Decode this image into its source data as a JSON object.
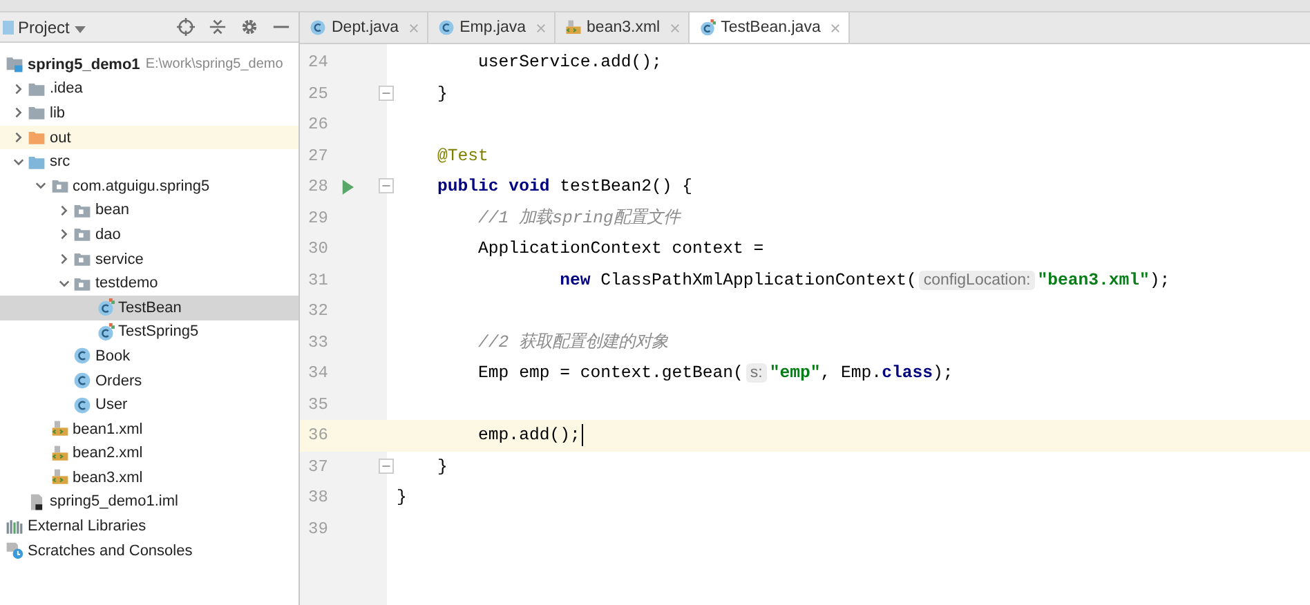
{
  "project_panel": {
    "title": "Project",
    "tree": [
      {
        "label": "spring5_demo1",
        "path": "E:\\work\\spring5_demo",
        "kind": "module",
        "selected": false,
        "highlighted": false,
        "children": [
          {
            "label": ".idea",
            "kind": "folder",
            "expanded": false,
            "selected": false,
            "highlighted": false
          },
          {
            "label": "lib",
            "kind": "folder",
            "expanded": false,
            "selected": false,
            "highlighted": false
          },
          {
            "label": "out",
            "kind": "excluded-folder",
            "expanded": false,
            "selected": false,
            "highlighted": true
          },
          {
            "label": "src",
            "kind": "source-folder",
            "expanded": true,
            "selected": false,
            "highlighted": false,
            "children": [
              {
                "label": "com.atguigu.spring5",
                "kind": "package",
                "expanded": true,
                "selected": false,
                "highlighted": false,
                "children": [
                  {
                    "label": "bean",
                    "kind": "package",
                    "expanded": false,
                    "selected": false,
                    "highlighted": false
                  },
                  {
                    "label": "dao",
                    "kind": "package",
                    "expanded": false,
                    "selected": false,
                    "highlighted": false
                  },
                  {
                    "label": "service",
                    "kind": "package",
                    "expanded": false,
                    "selected": false,
                    "highlighted": false
                  },
                  {
                    "label": "testdemo",
                    "kind": "package",
                    "expanded": true,
                    "selected": false,
                    "highlighted": false,
                    "children": [
                      {
                        "label": "TestBean",
                        "kind": "test-class",
                        "selected": true,
                        "highlighted": false
                      },
                      {
                        "label": "TestSpring5",
                        "kind": "test-class",
                        "selected": false,
                        "highlighted": false
                      }
                    ]
                  },
                  {
                    "label": "Book",
                    "kind": "class",
                    "selected": false,
                    "highlighted": false
                  },
                  {
                    "label": "Orders",
                    "kind": "class",
                    "selected": false,
                    "highlighted": false
                  },
                  {
                    "label": "User",
                    "kind": "class",
                    "selected": false,
                    "highlighted": false
                  }
                ]
              },
              {
                "label": "bean1.xml",
                "kind": "xml",
                "selected": false,
                "highlighted": false
              },
              {
                "label": "bean2.xml",
                "kind": "xml",
                "selected": false,
                "highlighted": false
              },
              {
                "label": "bean3.xml",
                "kind": "xml",
                "selected": false,
                "highlighted": false
              }
            ]
          },
          {
            "label": "spring5_demo1.iml",
            "kind": "iml",
            "selected": false,
            "highlighted": false
          }
        ]
      },
      {
        "label": "External Libraries",
        "kind": "libraries",
        "selected": false,
        "highlighted": false
      },
      {
        "label": "Scratches and Consoles",
        "kind": "scratches",
        "selected": false,
        "highlighted": false
      }
    ]
  },
  "editor": {
    "tabs": [
      {
        "label": "Dept.java",
        "kind": "class",
        "selected": false
      },
      {
        "label": "Emp.java",
        "kind": "class",
        "selected": false
      },
      {
        "label": "bean3.xml",
        "kind": "xml",
        "selected": false
      },
      {
        "label": "TestBean.java",
        "kind": "test-class",
        "selected": true
      }
    ],
    "lines": [
      {
        "number": "24",
        "current": false,
        "run_marker": false,
        "fold_marker": false,
        "segments": [
          {
            "kind": "plain",
            "text": "        userService.add();"
          }
        ]
      },
      {
        "number": "25",
        "current": false,
        "run_marker": false,
        "fold_marker": true,
        "segments": [
          {
            "kind": "plain",
            "text": "    }"
          }
        ]
      },
      {
        "number": "26",
        "current": false,
        "run_marker": false,
        "fold_marker": false
      },
      {
        "number": "27",
        "current": false,
        "run_marker": false,
        "fold_marker": false,
        "segments": [
          {
            "kind": "annotation",
            "text": "    @Test"
          }
        ]
      },
      {
        "number": "28",
        "current": false,
        "run_marker": true,
        "fold_marker": true,
        "segments": [
          {
            "kind": "keyword",
            "text": "    public void"
          },
          {
            "kind": "plain",
            "text": " testBean2() {"
          }
        ]
      },
      {
        "number": "29",
        "current": false,
        "run_marker": false,
        "fold_marker": false,
        "segments": [
          {
            "kind": "comment",
            "text": "        //1 加载spring配置文件"
          }
        ]
      },
      {
        "number": "30",
        "current": false,
        "run_marker": false,
        "fold_marker": false,
        "segments": [
          {
            "kind": "plain",
            "text": "        ApplicationContext context ="
          }
        ]
      },
      {
        "number": "31",
        "current": false,
        "run_marker": false,
        "fold_marker": false,
        "segments": [
          {
            "kind": "keyword",
            "text": "                new"
          },
          {
            "kind": "plain",
            "text": " ClassPathXmlApplicationContext("
          },
          {
            "kind": "hint",
            "text": "configLocation:"
          },
          {
            "kind": "string",
            "text": "\"bean3.xml\""
          },
          {
            "kind": "plain",
            "text": ");"
          }
        ]
      },
      {
        "number": "32",
        "current": false,
        "run_marker": false,
        "fold_marker": false
      },
      {
        "number": "33",
        "current": false,
        "run_marker": false,
        "fold_marker": false,
        "segments": [
          {
            "kind": "comment",
            "text": "        //2 获取配置创建的对象"
          }
        ]
      },
      {
        "number": "34",
        "current": false,
        "run_marker": false,
        "fold_marker": false,
        "segments": [
          {
            "kind": "plain",
            "text": "        Emp emp = context.getBean("
          },
          {
            "kind": "hint",
            "text": "s:"
          },
          {
            "kind": "string",
            "text": "\"emp\""
          },
          {
            "kind": "plain",
            "text": ", Emp."
          },
          {
            "kind": "keyword",
            "text": "class"
          },
          {
            "kind": "plain",
            "text": ");"
          }
        ]
      },
      {
        "number": "35",
        "current": false,
        "run_marker": false,
        "fold_marker": false
      },
      {
        "number": "36",
        "current": true,
        "run_marker": false,
        "fold_marker": false,
        "segments": [
          {
            "kind": "plain",
            "text": "        emp.add();"
          }
        ]
      },
      {
        "number": "37",
        "current": false,
        "run_marker": false,
        "fold_marker": true,
        "segments": [
          {
            "kind": "plain",
            "text": "    }"
          }
        ]
      },
      {
        "number": "38",
        "current": false,
        "run_marker": false,
        "fold_marker": false,
        "segments": [
          {
            "kind": "plain",
            "text": "}"
          }
        ]
      },
      {
        "number": "39",
        "current": false,
        "run_marker": false,
        "fold_marker": false
      }
    ]
  }
}
